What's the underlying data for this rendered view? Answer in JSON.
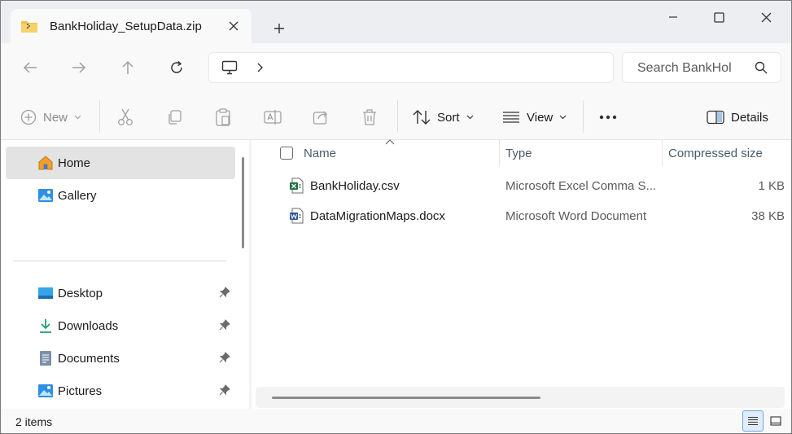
{
  "tab": {
    "title": "BankHoliday_SetupData.zip",
    "icon": "zip-folder-icon"
  },
  "toolbar": {
    "new_label": "New",
    "sort_label": "Sort",
    "view_label": "View",
    "details_label": "Details"
  },
  "search": {
    "placeholder": "Search BankHol"
  },
  "sidebar": {
    "items": [
      {
        "label": "Home",
        "icon": "home-icon",
        "selected": true
      },
      {
        "label": "Gallery",
        "icon": "gallery-icon"
      },
      {
        "label": "Desktop",
        "icon": "desktop-icon",
        "pinned": true
      },
      {
        "label": "Downloads",
        "icon": "download-icon",
        "pinned": true
      },
      {
        "label": "Documents",
        "icon": "documents-icon",
        "pinned": true
      },
      {
        "label": "Pictures",
        "icon": "pictures-icon",
        "pinned": true
      }
    ]
  },
  "filelist": {
    "columns": [
      "Name",
      "Type",
      "Compressed size"
    ],
    "rows": [
      {
        "name": "BankHoliday.csv",
        "type": "Microsoft Excel Comma S...",
        "size": "1 KB",
        "icon": "excel-file-icon"
      },
      {
        "name": "DataMigrationMaps.docx",
        "type": "Microsoft Word Document",
        "size": "38 KB",
        "icon": "word-file-icon"
      }
    ]
  },
  "status": {
    "item_count": "2 items"
  },
  "colors": {
    "accent": "#0067c0",
    "excel": "#1d6f42",
    "word": "#2b579a",
    "folder": "#f4c040"
  }
}
